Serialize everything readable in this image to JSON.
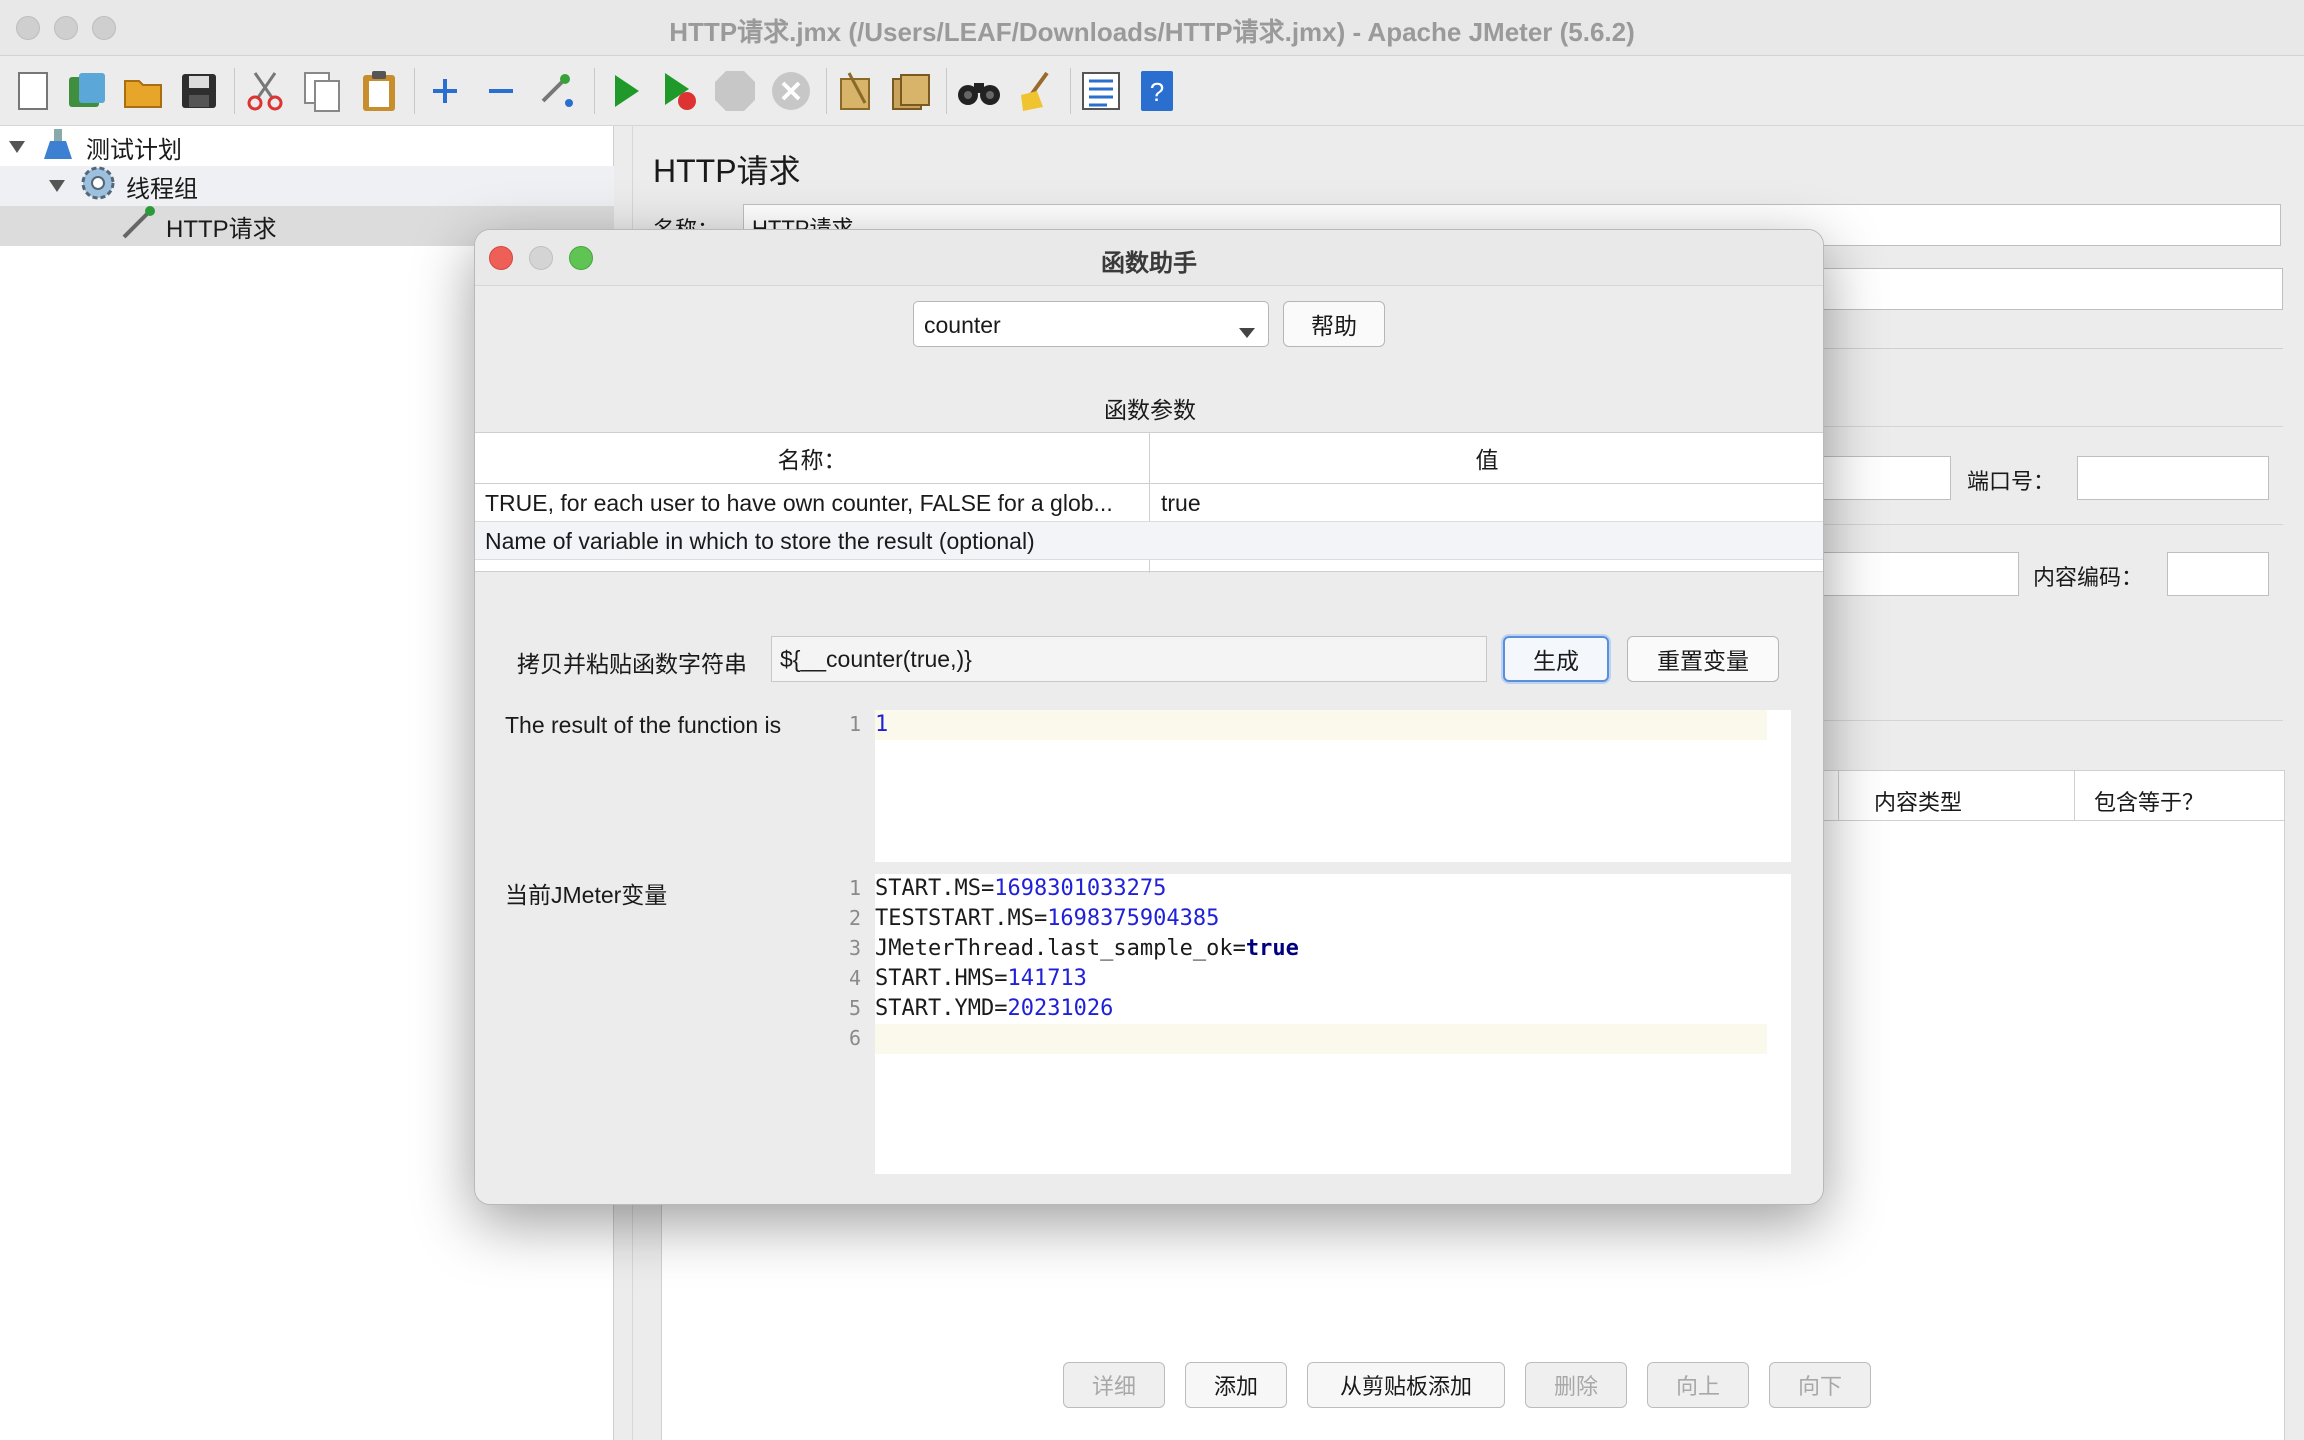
{
  "window": {
    "title": "HTTP请求.jmx (/Users/LEAF/Downloads/HTTP请求.jmx) - Apache JMeter (5.6.2)"
  },
  "toolbar": {
    "icons": [
      "new-icon",
      "templates-icon",
      "open-icon",
      "save-icon",
      "cut-icon",
      "copy-icon",
      "paste-icon",
      "expand-icon",
      "collapse-icon",
      "toggle-icon",
      "start-icon",
      "start-no-pause-icon",
      "stop-icon",
      "shutdown-icon",
      "clear-icon",
      "clear-all-icon",
      "search-icon",
      "reset-search-icon",
      "function-helper-icon",
      "help-icon"
    ]
  },
  "tree": {
    "items": [
      {
        "label": "测试计划",
        "icon": "flask-icon"
      },
      {
        "label": "线程组",
        "icon": "gear-icon"
      },
      {
        "label": "HTTP请求",
        "icon": "pipette-icon"
      }
    ]
  },
  "panel": {
    "title": "HTTP请求",
    "name_label": "名称：",
    "name_value": "HTTP请求",
    "port_label": "端口号：",
    "encoding_label": "内容编码：",
    "col_content_type": "内容类型",
    "col_include_equals": "包含等于？",
    "buttons": {
      "detail": "详细",
      "add": "添加",
      "add_clipboard": "从剪贴板添加",
      "delete": "删除",
      "up": "向上",
      "down": "向下"
    }
  },
  "dialog": {
    "title": "函数助手",
    "function_selected": "counter",
    "help_button": "帮助",
    "params_title": "函数参数",
    "col_name": "名称：",
    "col_value": "值",
    "params": [
      {
        "name": "TRUE, for each user to have own counter, FALSE for a glob...",
        "value": "true"
      },
      {
        "name": "Name of variable in which to store the result (optional)",
        "value": ""
      }
    ],
    "copy_label": "拷贝并粘贴函数字符串",
    "function_string": "${__counter(true,)}",
    "generate_button": "生成",
    "reset_button": "重置变量",
    "result_label": "The result of the function is",
    "result_lines": [
      {
        "n": "1",
        "text": "1"
      }
    ],
    "vars_label": "当前JMeter变量",
    "var_lines": [
      {
        "n": "1",
        "key": "START.MS=",
        "val": "1698301033275"
      },
      {
        "n": "2",
        "key": "TESTSTART.MS=",
        "val": "1698375904385"
      },
      {
        "n": "3",
        "key": "JMeterThread.last_sample_ok=",
        "val": "true"
      },
      {
        "n": "4",
        "key": "START.HMS=",
        "val": "141713"
      },
      {
        "n": "5",
        "key": "START.YMD=",
        "val": "20231026"
      },
      {
        "n": "6",
        "key": "",
        "val": ""
      }
    ]
  }
}
